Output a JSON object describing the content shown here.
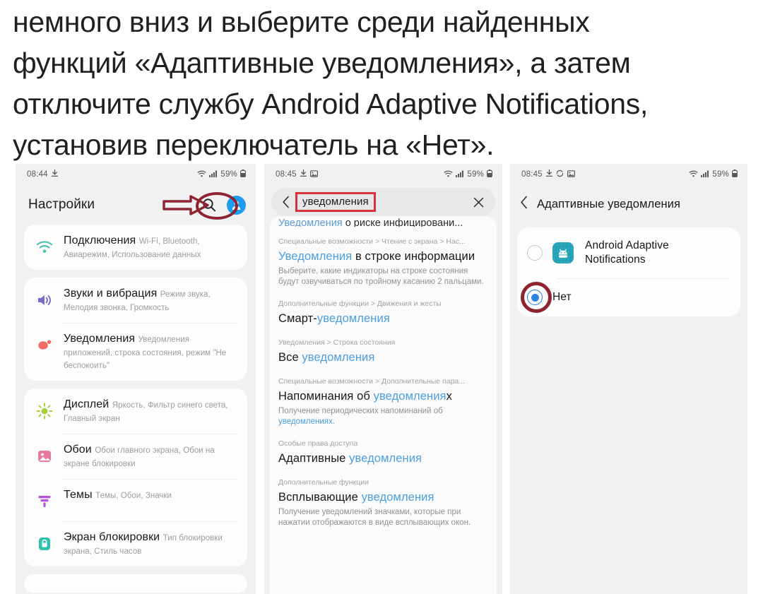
{
  "heading": {
    "line1": "немного вниз и выберите среди найденных",
    "line2": "функций «Адаптивные уведомления», а затем",
    "line3": "отключите службу Android Adaptive Notifications,",
    "line4": "установив переключатель на «Нет»."
  },
  "colors": {
    "annotation_red": "#8d2430",
    "box_red": "#d9323c",
    "link_blue": "#4a9fe0",
    "accent_blue": "#2d86e0",
    "avatar_blue": "#1f9bf0",
    "phone_bg": "#f1f1f1",
    "card_bg": "#fdfdfd"
  },
  "phone1": {
    "status": {
      "time": "08:44",
      "left_icons": [
        "download-icon"
      ],
      "right_icons": [
        "wifi-icon",
        "signal-icon"
      ],
      "battery_percent": "59%"
    },
    "appbar": {
      "title": "Настройки",
      "search_icon": "search-icon",
      "avatar_icon": "account-avatar"
    },
    "groups": [
      {
        "items": [
          {
            "icon": "wifi-icon",
            "icon_color": "#4cc2b0",
            "title": "Подключения",
            "subtitle": "Wi-Fi, Bluetooth, Авиарежим, Использование данных"
          }
        ]
      },
      {
        "items": [
          {
            "icon": "speaker-icon",
            "icon_color": "#7b68c9",
            "title": "Звуки и вибрация",
            "subtitle": "Режим звука, Мелодия звонка, Громкость"
          },
          {
            "icon": "notification-bubble-icon",
            "icon_color": "#ef6b63",
            "title": "Уведомления",
            "subtitle": "Уведомления приложений, строка состояния, режим \"Не беспокоить\""
          }
        ]
      },
      {
        "items": [
          {
            "icon": "brightness-icon",
            "icon_color": "#a8cf3a",
            "title": "Дисплей",
            "subtitle": "Яркость, Фильтр синего света, Главный экран"
          },
          {
            "icon": "wallpaper-icon",
            "icon_color": "#e8799f",
            "title": "Обои",
            "subtitle": "Обои главного экрана, Обои на экране блокировки"
          },
          {
            "icon": "themes-icon",
            "icon_color": "#b556d8",
            "title": "Темы",
            "subtitle": "Темы, Обои, Значки"
          },
          {
            "icon": "lock-icon",
            "icon_color": "#2cc0ae",
            "title": "Экран блокировки",
            "subtitle": "Тип блокировки экрана, Стиль часов"
          }
        ]
      }
    ]
  },
  "phone2": {
    "status": {
      "time": "08:45",
      "left_icons": [
        "download-icon",
        "image-icon"
      ],
      "right_icons": [
        "wifi-icon",
        "signal-icon"
      ],
      "battery_percent": "59%"
    },
    "search": {
      "back_icon": "chevron-left-icon",
      "query": "уведомления",
      "clear_icon": "close-icon"
    },
    "cut_result": {
      "highlight": "Уведомления",
      "rest": " о риске инфицировани..."
    },
    "results": [
      {
        "breadcrumb": "Специальные возможности > Чтение с экрана > Нас...",
        "headline_pre": "",
        "headline_hl": "Уведомления",
        "headline_post": " в строке информации",
        "desc_pre": "Выберите, какие индикаторы на строке состояния будут озвучиваться по тройному касанию 2 пальцами.",
        "desc_hl": "",
        "desc_post": ""
      },
      {
        "breadcrumb": "Дополнительные функции > Движения и жесты",
        "headline_pre": "Смарт-",
        "headline_hl": "уведомления",
        "headline_post": "",
        "desc_pre": "",
        "desc_hl": "",
        "desc_post": ""
      },
      {
        "breadcrumb": "Уведомления > Строка состояния",
        "headline_pre": "Все ",
        "headline_hl": "уведомления",
        "headline_post": "",
        "desc_pre": "",
        "desc_hl": "",
        "desc_post": ""
      },
      {
        "breadcrumb": "Специальные возможности > Дополнительные пара...",
        "headline_pre": "Напоминания об ",
        "headline_hl": "уведомления",
        "headline_post": "х",
        "desc_pre": "Получение периодических напоминаний об ",
        "desc_hl": "уведомлениях",
        "desc_post": "."
      },
      {
        "breadcrumb": "Особые права доступа",
        "headline_pre": "Адаптивные ",
        "headline_hl": "уведомления",
        "headline_post": "",
        "desc_pre": "",
        "desc_hl": "",
        "desc_post": ""
      },
      {
        "breadcrumb": "Дополнительные функции",
        "headline_pre": "Всплывающие ",
        "headline_hl": "уведомления",
        "headline_post": "",
        "desc_pre": "Получение уведомлений значками, которые при нажатии отображаются в виде всплывающих окон.",
        "desc_hl": "",
        "desc_post": ""
      }
    ]
  },
  "phone3": {
    "status": {
      "time": "08:45",
      "left_icons": [
        "download-icon",
        "sync-icon",
        "image-icon"
      ],
      "right_icons": [
        "wifi-icon",
        "signal-icon"
      ],
      "battery_percent": "59%"
    },
    "appbar": {
      "back_icon": "chevron-left-icon",
      "title": "Адаптивные уведомления"
    },
    "options": [
      {
        "label_line1": "Android Adaptive",
        "label_line2": "Notifications",
        "icon": "android-app-icon",
        "selected": false
      },
      {
        "label_line1": "Нет",
        "label_line2": "",
        "icon": "",
        "selected": true
      }
    ]
  }
}
